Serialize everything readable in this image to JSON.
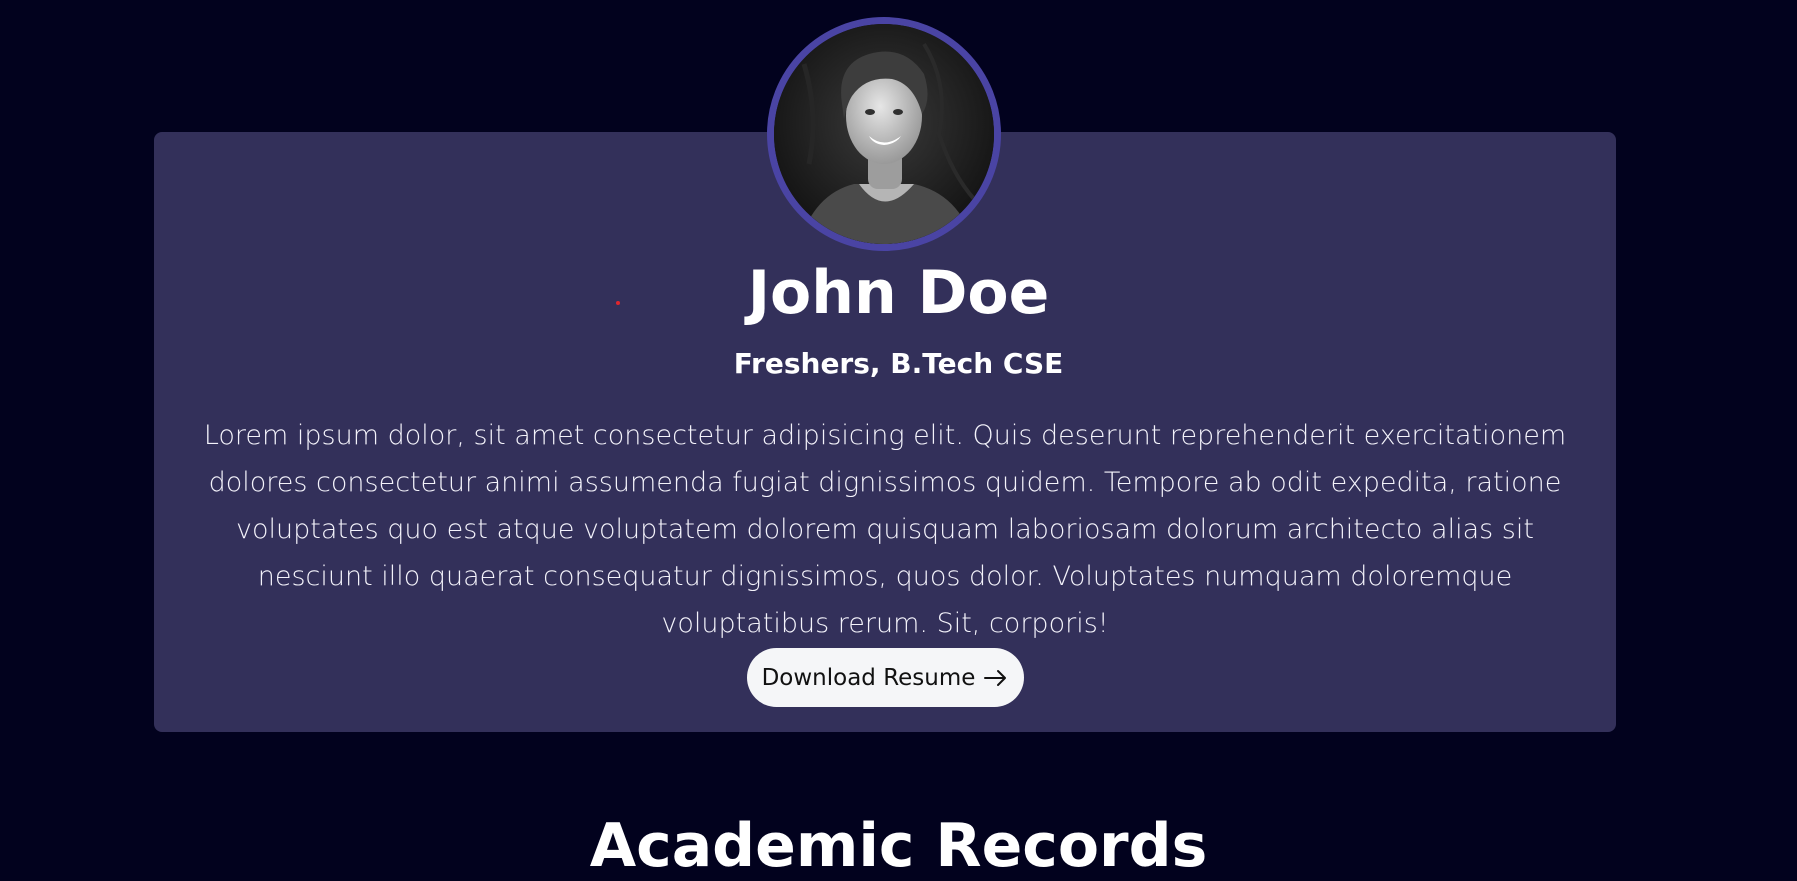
{
  "profile": {
    "name": "John Doe",
    "subtitle": "Freshers, B.Tech CSE",
    "bio": "Lorem ipsum dolor, sit amet consectetur adipisicing elit. Quis deserunt reprehenderit exercitationem dolores consectetur animi assumenda fugiat dignissimos quidem. Tempore ab odit expedita, ratione voluptates quo est atque voluptatem dolorem quisquam laboriosam dolorum architecto alias sit nesciunt illo quaerat consequatur dignissimos, quos dolor. Voluptates numquam doloremque voluptatibus rerum. Sit, corporis!",
    "resume_button_label": "Download Resume",
    "resume_button_icon": "arrow-right-icon"
  },
  "sections": {
    "academic_title": "Academic Records"
  },
  "colors": {
    "page_background": "#02021e",
    "card_background": "#33305a",
    "avatar_border": "#4a44a4",
    "button_background": "#f5f6f8",
    "text": "#ffffff"
  }
}
